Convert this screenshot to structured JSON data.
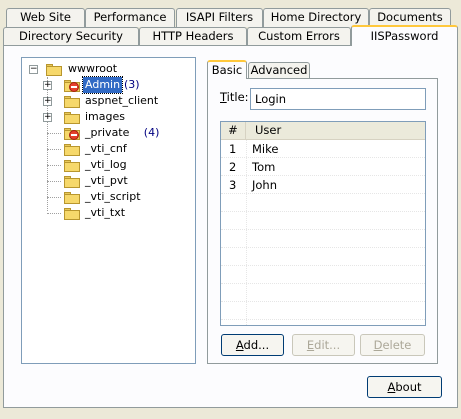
{
  "tabs_row1": [
    "Web Site",
    "Performance",
    "ISAPI Filters",
    "Home Directory",
    "Documents"
  ],
  "tabs_row2": [
    "Directory Security",
    "HTTP Headers",
    "Custom Errors",
    "IISPassword"
  ],
  "active_tab": "IISPassword",
  "tree": {
    "root": "wwwroot",
    "items": [
      {
        "label": "Admin",
        "count": "(3)",
        "expandable": true,
        "protected": true,
        "selected": true
      },
      {
        "label": "aspnet_client",
        "count": "",
        "expandable": true,
        "protected": false
      },
      {
        "label": "images",
        "count": "",
        "expandable": true,
        "protected": false
      },
      {
        "label": "_private",
        "count": "(4)",
        "expandable": false,
        "protected": true
      },
      {
        "label": "_vti_cnf",
        "count": "",
        "expandable": false,
        "protected": false
      },
      {
        "label": "_vti_log",
        "count": "",
        "expandable": false,
        "protected": false
      },
      {
        "label": "_vti_pvt",
        "count": "",
        "expandable": false,
        "protected": false
      },
      {
        "label": "_vti_script",
        "count": "",
        "expandable": false,
        "protected": false
      },
      {
        "label": "_vti_txt",
        "count": "",
        "expandable": false,
        "protected": false
      }
    ]
  },
  "inner_tabs": {
    "basic": "Basic",
    "advanced": "Advanced"
  },
  "title_field": {
    "label_prefix": "T",
    "label_rest": "itle:",
    "value": "Login"
  },
  "users_list": {
    "col_num": "#",
    "col_user": "User",
    "rows": [
      {
        "num": "1",
        "user": "Mike"
      },
      {
        "num": "2",
        "user": "Tom"
      },
      {
        "num": "3",
        "user": "John"
      }
    ]
  },
  "buttons": {
    "add": {
      "accel": "A",
      "rest": "dd..."
    },
    "edit": {
      "accel": "E",
      "rest": "dit..."
    },
    "delete": {
      "accel": "D",
      "rest": "elete"
    },
    "about": {
      "accel": "A",
      "rest": "bout"
    }
  },
  "colors": {
    "selection": "#316ac5",
    "tab_highlight": "#ffc83c",
    "protect_icon": "#e5402c"
  }
}
